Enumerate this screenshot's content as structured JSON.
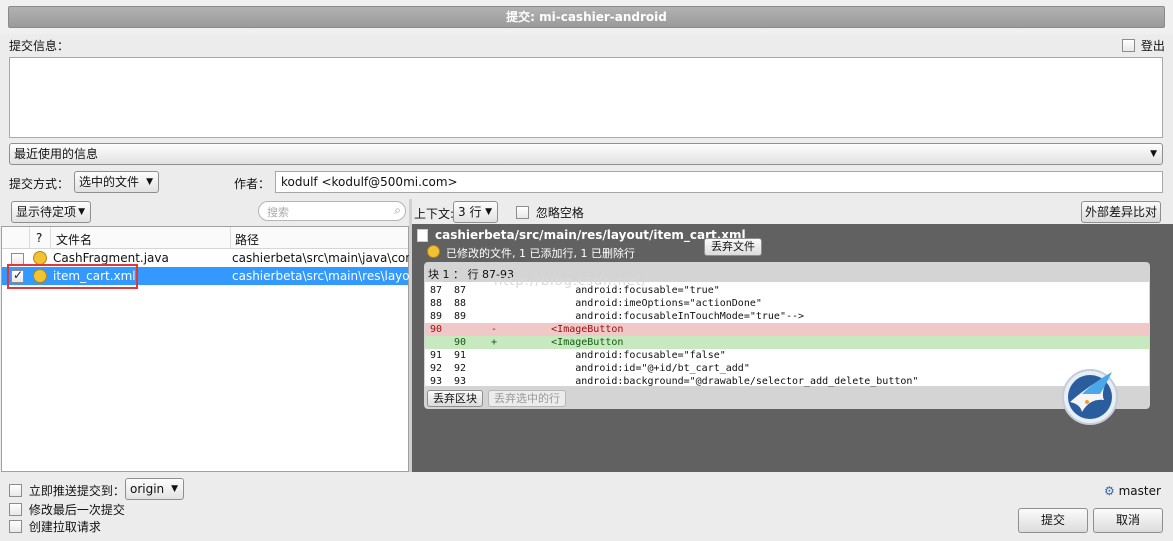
{
  "window": {
    "title": "提交: mi-cashier-android"
  },
  "message": {
    "label": "提交信息：",
    "logout_label": "登出",
    "recent_label": "最近使用的信息"
  },
  "commit_options": {
    "mode_label": "提交方式：",
    "mode_value": "选中的文件",
    "author_label": "作者：",
    "author_value": "kodulf <kodulf@500mi.com>"
  },
  "file_list": {
    "filter_value": "显示待定项",
    "search_placeholder": "搜索",
    "col_check": "?",
    "col_name": "文件名",
    "col_path": "路径",
    "files": [
      {
        "name": "CashFragment.java",
        "path": "cashierbeta\\src\\main\\java\\con",
        "checked": false,
        "selected": false
      },
      {
        "name": "item_cart.xml",
        "path": "cashierbeta\\src\\main\\res\\layo",
        "checked": true,
        "selected": true
      }
    ]
  },
  "diff": {
    "context_label": "上下文:",
    "context_value": "3 行",
    "ignore_ws_label": "忽略空格",
    "external_diff_label": "外部差异比对",
    "file_path": "cashierbeta/src/main/res/layout/item_cart.xml",
    "file_status": "已修改的文件, 1 已添加行, 1 已删除行",
    "discard_file_label": "丢弃文件",
    "hunk_header": "块 1 ： 行 87-93",
    "lines": [
      {
        "old": "87",
        "new": "87",
        "sign": "",
        "text": "            android:focusable=\"true\"",
        "type": "ctx"
      },
      {
        "old": "88",
        "new": "88",
        "sign": "",
        "text": "            android:imeOptions=\"actionDone\"",
        "type": "ctx"
      },
      {
        "old": "89",
        "new": "89",
        "sign": "",
        "text": "            android:focusableInTouchMode=\"true\"-->",
        "type": "ctx"
      },
      {
        "old": "90",
        "new": "",
        "sign": "-",
        "text": "        <ImageButton",
        "type": "del"
      },
      {
        "old": "",
        "new": "90",
        "sign": "+",
        "text": "        <ImageButton",
        "type": "add"
      },
      {
        "old": "91",
        "new": "91",
        "sign": "",
        "text": "            android:focusable=\"false\"",
        "type": "ctx"
      },
      {
        "old": "92",
        "new": "92",
        "sign": "",
        "text": "            android:id=\"@+id/bt_cart_add\"",
        "type": "ctx"
      },
      {
        "old": "93",
        "new": "93",
        "sign": "",
        "text": "            android:background=\"@drawable/selector_add_delete_button\"",
        "type": "ctx"
      }
    ],
    "discard_hunk_label": "丢弃区块",
    "discard_selected_label": "丢弃选中的行",
    "watermark": "http://blog.csdn.net/"
  },
  "footer": {
    "push_label": "立即推送提交到：",
    "push_remote": "origin",
    "amend_label": "修改最后一次提交",
    "pr_label": "创建拉取请求",
    "branch": "master",
    "commit_label": "提交",
    "cancel_label": "取消"
  },
  "colors": {
    "selected_row": "#3399ff",
    "deleted_line": "#f0c8c8",
    "added_line": "#c8e8c0",
    "highlight_box": "#e0383a"
  }
}
